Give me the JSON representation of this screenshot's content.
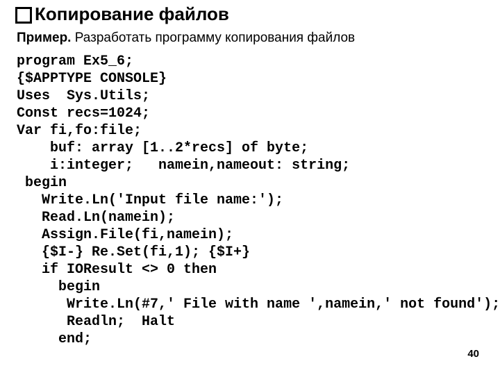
{
  "title": "Копирование файлов",
  "subtitle_bold": "Пример.",
  "subtitle_rest": " Разработать программу копирования файлов",
  "code": "program Ex5_6;\n{$APPTYPE CONSOLE}\nUses  Sys.Utils;\nConst recs=1024;\nVar fi,fo:file;\n    buf: array [1..2*recs] of byte;\n    i:integer;   namein,nameout: string;\n begin\n   Write.Ln('Input file name:');\n   Read.Ln(namein);\n   Assign.File(fi,namein);\n   {$I-} Re.Set(fi,1); {$I+}\n   if IOResult <> 0 then\n     begin\n      Write.Ln(#7,' File with name ',namein,' not found');\n      Readln;  Halt\n     end;",
  "page": "40"
}
